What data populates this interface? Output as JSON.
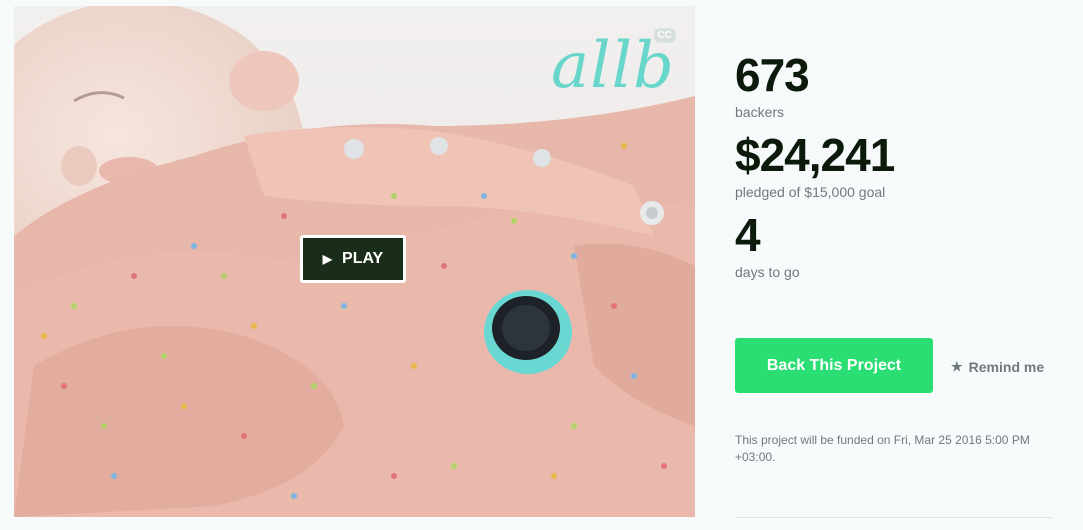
{
  "video": {
    "brand_logo": "allb",
    "cc_badge": "CC",
    "play_icon": "▶",
    "play_label": "PLAY"
  },
  "stats": {
    "backers_count": "673",
    "backers_label": "backers",
    "pledged_amount": "$24,241",
    "pledged_label": "pledged of $15,000 goal",
    "days_count": "4",
    "days_label": "days to go"
  },
  "actions": {
    "back_label": "Back This Project",
    "remind_icon": "★",
    "remind_label": "Remind me"
  },
  "funding_note": "This project will be funded on Fri, Mar 25 2016 5:00 PM +03:00.",
  "colors": {
    "primary_green": "#2bde73",
    "stat_text": "#0c1a0c",
    "muted_text": "#6e7a7e",
    "brand_teal": "#69d6cb"
  }
}
